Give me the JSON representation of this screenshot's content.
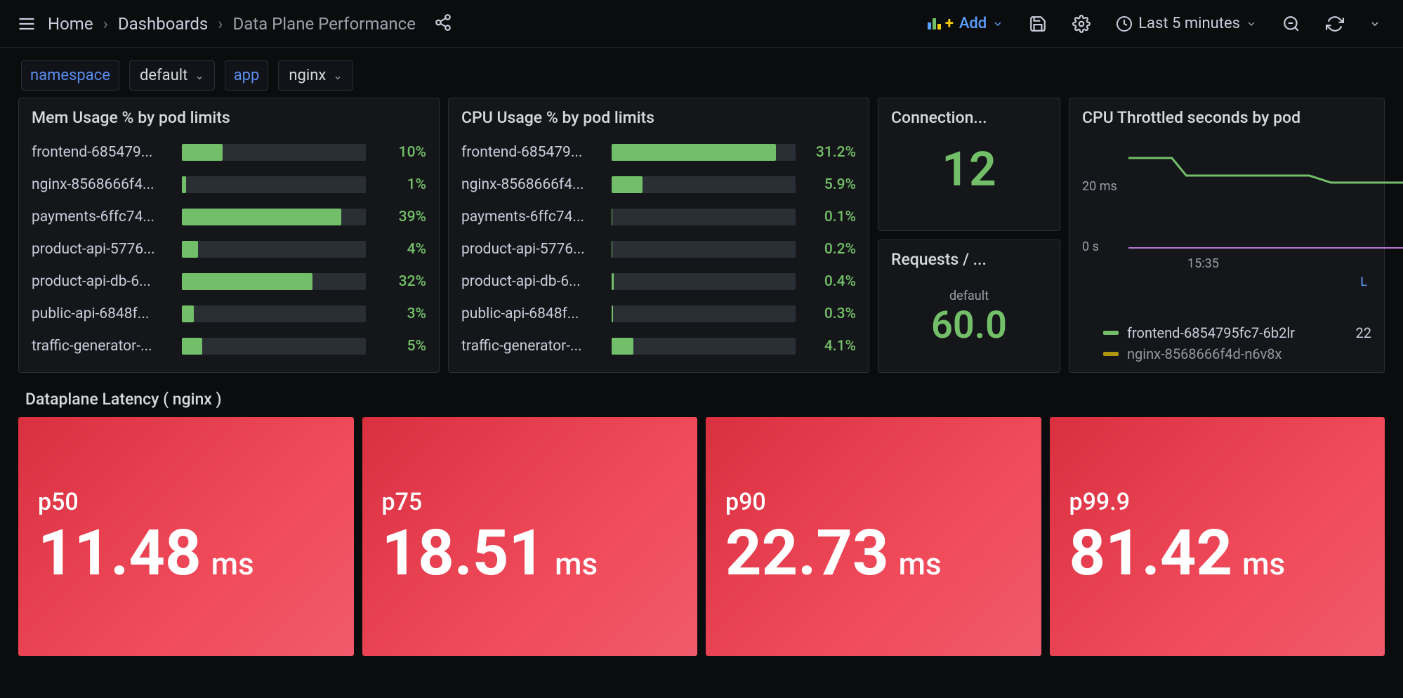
{
  "breadcrumb": {
    "home": "Home",
    "dashboards": "Dashboards",
    "current": "Data Plane Performance"
  },
  "topbar": {
    "add": "Add",
    "timerange": "Last 5 minutes"
  },
  "variables": {
    "namespace_label": "namespace",
    "namespace_value": "default",
    "app_label": "app",
    "app_value": "nginx"
  },
  "mem_panel": {
    "title": "Mem Usage % by pod limits",
    "rows": [
      {
        "label": "frontend-685479...",
        "pct": 10,
        "text": "10%"
      },
      {
        "label": "nginx-8568666f4...",
        "pct": 1,
        "text": "1%"
      },
      {
        "label": "payments-6ffc74...",
        "pct": 39,
        "text": "39%"
      },
      {
        "label": "product-api-5776...",
        "pct": 4,
        "text": "4%"
      },
      {
        "label": "product-api-db-6...",
        "pct": 32,
        "text": "32%"
      },
      {
        "label": "public-api-6848f...",
        "pct": 3,
        "text": "3%"
      },
      {
        "label": "traffic-generator-...",
        "pct": 5,
        "text": "5%"
      }
    ]
  },
  "cpu_panel": {
    "title": "CPU Usage % by pod limits",
    "rows": [
      {
        "label": "frontend-685479...",
        "pct": 31.2,
        "text": "31.2%"
      },
      {
        "label": "nginx-8568666f4...",
        "pct": 5.9,
        "text": "5.9%"
      },
      {
        "label": "payments-6ffc74...",
        "pct": 0.1,
        "text": "0.1%"
      },
      {
        "label": "product-api-5776...",
        "pct": 0.2,
        "text": "0.2%"
      },
      {
        "label": "product-api-db-6...",
        "pct": 0.4,
        "text": "0.4%"
      },
      {
        "label": "public-api-6848f...",
        "pct": 0.3,
        "text": "0.3%"
      },
      {
        "label": "traffic-generator-...",
        "pct": 4.1,
        "text": "4.1%"
      }
    ]
  },
  "connections": {
    "title": "Connection...",
    "value": "12"
  },
  "requests": {
    "title": "Requests / ...",
    "sub": "default",
    "value": "60.0"
  },
  "throttled": {
    "title": "CPU Throttled seconds by pod",
    "ytick_top": "20 ms",
    "ytick_bot": "0 s",
    "xtick": "15:35",
    "legend": [
      {
        "color": "#73bf69",
        "label": "frontend-6854795fc7-6b2lr",
        "val": "22"
      },
      {
        "color": "#f2cc0c",
        "label": "nginx-8568666f4d-n6v8x",
        "val": ""
      }
    ]
  },
  "latency_section": "Dataplane Latency ( nginx )",
  "latency": [
    {
      "label": "p50",
      "value": "11.48",
      "unit": "ms"
    },
    {
      "label": "p75",
      "value": "18.51",
      "unit": "ms"
    },
    {
      "label": "p90",
      "value": "22.73",
      "unit": "ms"
    },
    {
      "label": "p99.9",
      "value": "81.42",
      "unit": "ms"
    }
  ],
  "chart_data": {
    "type": "bar",
    "panels": [
      {
        "title": "Mem Usage % by pod limits",
        "categories": [
          "frontend-685479...",
          "nginx-8568666f4...",
          "payments-6ffc74...",
          "product-api-5776...",
          "product-api-db-6...",
          "public-api-6848f...",
          "traffic-generator-..."
        ],
        "values": [
          10,
          1,
          39,
          4,
          32,
          3,
          5
        ],
        "unit": "%"
      },
      {
        "title": "CPU Usage % by pod limits",
        "categories": [
          "frontend-685479...",
          "nginx-8568666f4...",
          "payments-6ffc74...",
          "product-api-5776...",
          "product-api-db-6...",
          "public-api-6848f...",
          "traffic-generator-..."
        ],
        "values": [
          31.2,
          5.9,
          0.1,
          0.2,
          0.4,
          0.3,
          4.1
        ],
        "unit": "%"
      },
      {
        "title": "CPU Throttled seconds by pod",
        "type": "line",
        "ylabel": "",
        "ylim": [
          "0 s",
          "20 ms"
        ],
        "xtick": "15:35",
        "series": [
          {
            "name": "frontend-6854795fc7-6b2lr",
            "color": "#73bf69"
          },
          {
            "name": "nginx-8568666f4d-n6v8x",
            "color": "#f2cc0c"
          }
        ]
      }
    ],
    "stats": [
      {
        "title": "Connection...",
        "value": 12
      },
      {
        "title": "Requests / ...",
        "value": 60.0,
        "sub": "default"
      }
    ],
    "latency": [
      {
        "label": "p50",
        "value_ms": 11.48
      },
      {
        "label": "p75",
        "value_ms": 18.51
      },
      {
        "label": "p90",
        "value_ms": 22.73
      },
      {
        "label": "p99.9",
        "value_ms": 81.42
      }
    ]
  }
}
